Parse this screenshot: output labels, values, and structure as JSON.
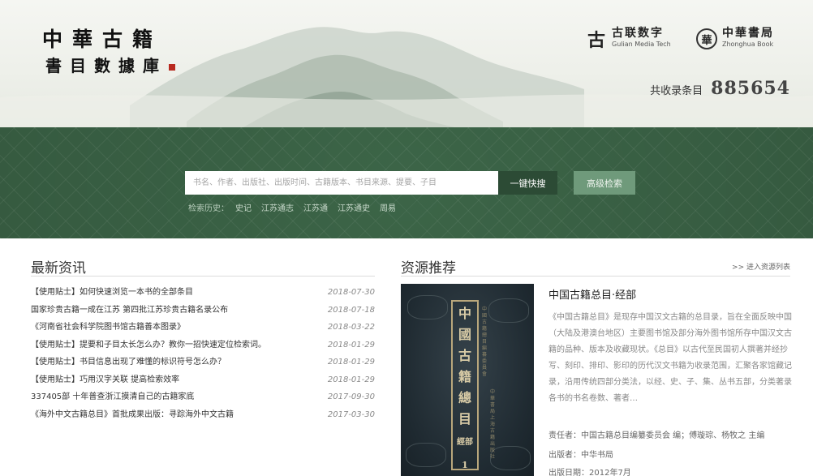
{
  "header": {
    "title_line1": "中華古籍",
    "title_line2": "書目數據庫",
    "partners": [
      {
        "cn": "古联数字",
        "en": "Gulian Media Tech",
        "icon": "gulian-logo-icon"
      },
      {
        "cn": "中華書局",
        "en": "Zhonghua Book",
        "icon": "zhonghua-seal-icon"
      }
    ],
    "count_label": "共收录条目",
    "count_value": "885654"
  },
  "search": {
    "placeholder": "书名、作者、出版社、出版时间、古籍版本、书目来源、提要、子目",
    "quick_search_label": "一键快搜",
    "advanced_label": "高级检索",
    "history_label": "检索历史：",
    "history_items": [
      "史记",
      "江苏通志",
      "江苏通",
      "江苏通史",
      "周易"
    ]
  },
  "news": {
    "title": "最新资讯",
    "items": [
      {
        "title": "【使用贴士】如何快速浏览一本书的全部条目",
        "date": "2018-07-30"
      },
      {
        "title": "国家珍贵古籍一成在江苏 第四批江苏珍贵古籍名录公布",
        "date": "2018-07-18"
      },
      {
        "title": "《河南省社会科学院图书馆古籍善本图录》",
        "date": "2018-03-22"
      },
      {
        "title": "【使用贴士】提要和子目太长怎么办？教你一招快速定位检索词。",
        "date": "2018-01-29"
      },
      {
        "title": "【使用贴士】书目信息出现了难懂的标识符号怎么办？",
        "date": "2018-01-29"
      },
      {
        "title": "【使用贴士】巧用汉字关联 提高检索效率",
        "date": "2018-01-29"
      },
      {
        "title": "337405部 十年普查浙江摸清自己的古籍家底",
        "date": "2017-09-30"
      },
      {
        "title": "《海外中文古籍总目》首批成果出版：寻踪海外中文古籍",
        "date": "2017-03-30"
      }
    ]
  },
  "resources": {
    "title": "资源推荐",
    "more_label": ">> 进入资源列表",
    "book": {
      "cover_title": "中國古籍總目",
      "cover_sub": "經部",
      "cover_volume": "1",
      "cover_side_text": "中國古籍總目編纂委員會",
      "cover_side_text2": "中華書局上海古籍出版社",
      "name": "中国古籍总目·经部",
      "description": "《中国古籍总目》是现存中国汉文古籍的总目录，旨在全面反映中国（大陆及港澳台地区）主要图书馆及部分海外图书馆所存中国汉文古籍的品种、版本及收藏现状。《总目》以古代至民国初人撰著并经抄写、刻印、排印、影印的历代汉文书籍为收录范围，汇聚各家馆藏记录，沿用传统四部分类法，以经、史、子、集、丛书五部，分类著录各书的书名卷数、著者…",
      "editor_label": "责任者：",
      "editor": "中国古籍总目编纂委员会 编；傅璇琮、杨牧之 主编",
      "publisher_label": "出版者：",
      "publisher": "中华书局",
      "date_label": "出版日期：",
      "date": "2012年7月"
    }
  },
  "colors": {
    "band_green": "#3f6a4b",
    "button_dark": "#2c4b35",
    "button_light": "#6f9a7b",
    "seal_red": "#b8291f"
  }
}
